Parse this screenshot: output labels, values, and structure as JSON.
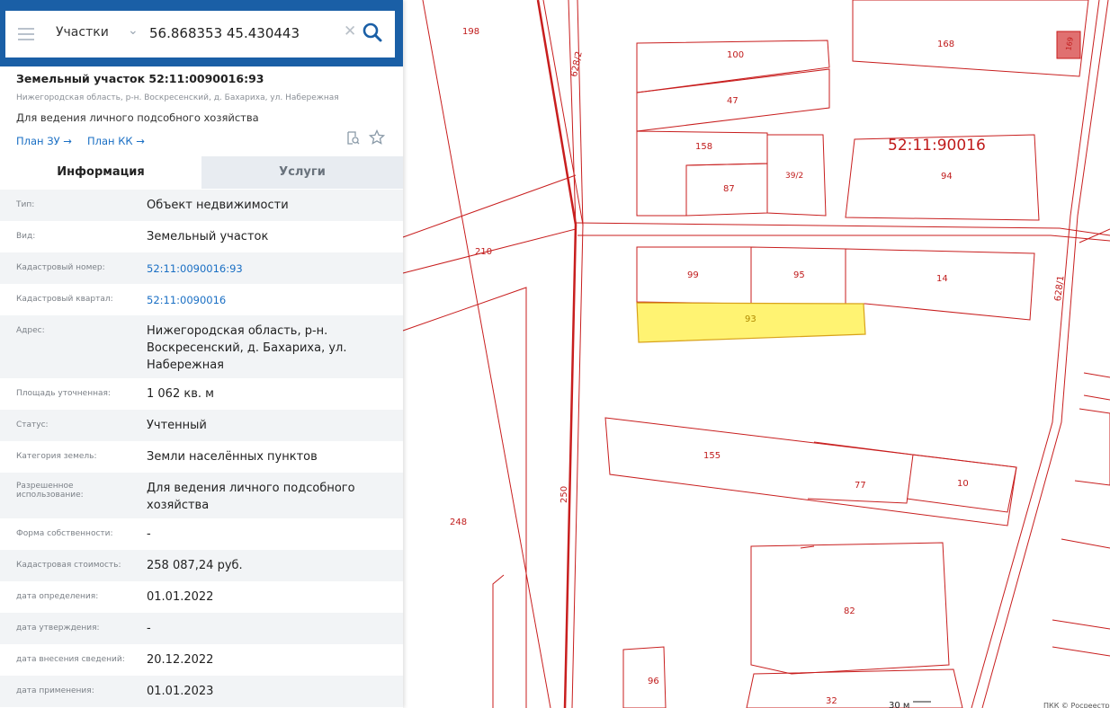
{
  "search": {
    "layer": "Участки",
    "query": "56.868353 45.430443"
  },
  "parcel": {
    "title": "Земельный участок 52:11:0090016:93",
    "address": "Нижегородская область, р-н. Воскресенский, д. Бахариха, ул. Набережная",
    "use": "Для ведения личного подсобного хозяйства",
    "plan_links": [
      "План ЗУ →",
      "План КК →"
    ]
  },
  "tabs": [
    "Информация",
    "Услуги"
  ],
  "info_rows": [
    {
      "label": "Тип:",
      "value": "Объект недвижимости"
    },
    {
      "label": "Вид:",
      "value": "Земельный участок"
    },
    {
      "label": "Кадастровый номер:",
      "value": "52:11:0090016:93"
    },
    {
      "label": "Кадастровый квартал:",
      "value": "52:11:0090016"
    },
    {
      "label": "Адрес:",
      "value": "Нижегородская область, р-н. Воскресенский, д. Бахариха, ул. Набережная"
    },
    {
      "label": "Площадь уточненная:",
      "value": "1 062 кв. м"
    },
    {
      "label": "Статус:",
      "value": "Учтенный"
    },
    {
      "label": "Категория земель:",
      "value": "Земли населённых пунктов"
    },
    {
      "label": "Разрешенное использование:",
      "value": "Для ведения личного подсобного хозяйства"
    },
    {
      "label": "Форма собственности:",
      "value": "-"
    },
    {
      "label": "Кадастровая стоимость:",
      "value": "258 087,24 руб."
    },
    {
      "label": "дата определения:",
      "value": "01.01.2022"
    },
    {
      "label": "дата утверждения:",
      "value": "-"
    },
    {
      "label": "дата внесения сведений:",
      "value": "20.12.2022"
    },
    {
      "label": "дата применения:",
      "value": "01.01.2023"
    }
  ],
  "map": {
    "quarter_label": "52:11:90016",
    "parcel_labels": [
      "198",
      "100",
      "168",
      "169",
      "628/2",
      "47",
      "158",
      "39/2",
      "87",
      "94",
      "210",
      "99",
      "95",
      "14",
      "628/1",
      "93",
      "155",
      "77",
      "10",
      "250",
      "248",
      "82",
      "96",
      "32"
    ],
    "scale": "30 м",
    "attribution": "ПКК © Росреестр",
    "colors": {
      "boundary": "#c81e1e",
      "selected_fill": "#fff372",
      "selected_stroke": "#d8a21b"
    }
  }
}
